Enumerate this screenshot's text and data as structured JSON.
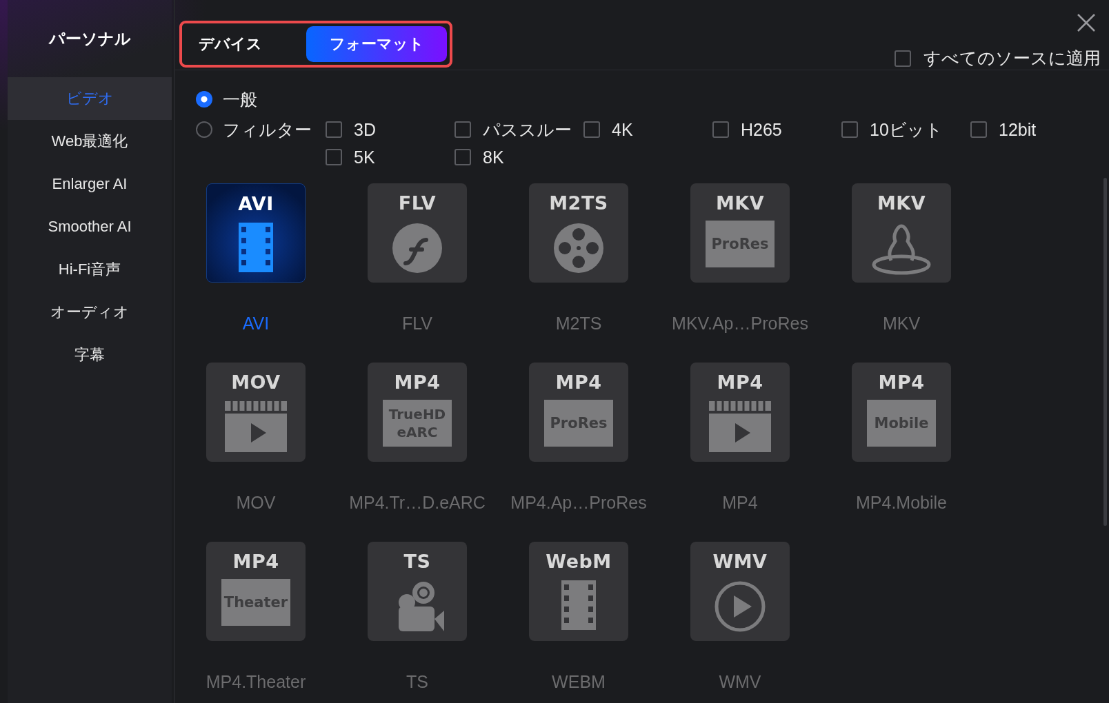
{
  "sidebar": {
    "title": "パーソナル",
    "items": [
      {
        "label": "ビデオ",
        "selected": true
      },
      {
        "label": "Web最適化",
        "selected": false
      },
      {
        "label": "Enlarger AI",
        "selected": false
      },
      {
        "label": "Smoother AI",
        "selected": false
      },
      {
        "label": "Hi-Fi音声",
        "selected": false
      },
      {
        "label": "オーディオ",
        "selected": false
      },
      {
        "label": "字幕",
        "selected": false
      }
    ]
  },
  "tabs": [
    {
      "label": "デバイス",
      "selected": false
    },
    {
      "label": "フォーマット",
      "selected": true
    }
  ],
  "apply_all": {
    "label": "すべてのソースに適用",
    "checked": false
  },
  "modes": [
    {
      "label": "一般",
      "selected": true
    },
    {
      "label": "フィルター",
      "selected": false
    }
  ],
  "filters": [
    {
      "label": "3D",
      "checked": false
    },
    {
      "label": "パススルー",
      "checked": false
    },
    {
      "label": "4K",
      "checked": false
    },
    {
      "label": "H265",
      "checked": false
    },
    {
      "label": "10ビット",
      "checked": false
    },
    {
      "label": "12bit",
      "checked": false
    },
    {
      "label": "5K",
      "checked": false
    },
    {
      "label": "8K",
      "checked": false
    }
  ],
  "formats": [
    {
      "tag": "AVI",
      "kind": "film",
      "label": "AVI",
      "selected": true
    },
    {
      "tag": "FLV",
      "kind": "flash",
      "label": "FLV",
      "selected": false
    },
    {
      "tag": "M2TS",
      "kind": "reel",
      "label": "M2TS",
      "selected": false
    },
    {
      "tag": "MKV",
      "kind": "plate",
      "plate": "ProRes",
      "label": "MKV.Ap…ProRes",
      "selected": false
    },
    {
      "tag": "MKV",
      "kind": "figure",
      "label": "MKV",
      "selected": false
    },
    {
      "tag": "MOV",
      "kind": "clapper",
      "label": "MOV",
      "selected": false
    },
    {
      "tag": "MP4",
      "kind": "plate",
      "plate": "TrueHD eARC",
      "label": "MP4.Tr…D.eARC",
      "selected": false
    },
    {
      "tag": "MP4",
      "kind": "plate",
      "plate": "ProRes",
      "label": "MP4.Ap…ProRes",
      "selected": false
    },
    {
      "tag": "MP4",
      "kind": "clapper",
      "label": "MP4",
      "selected": false
    },
    {
      "tag": "MP4",
      "kind": "plate",
      "plate": "Mobile",
      "label": "MP4.Mobile",
      "selected": false
    },
    {
      "tag": "MP4",
      "kind": "plate",
      "plate": "Theater",
      "label": "MP4.Theater",
      "selected": false
    },
    {
      "tag": "TS",
      "kind": "camera",
      "label": "TS",
      "selected": false
    },
    {
      "tag": "WebM",
      "kind": "film",
      "label": "WEBM",
      "selected": false
    },
    {
      "tag": "WMV",
      "kind": "play",
      "label": "WMV",
      "selected": false
    }
  ]
}
